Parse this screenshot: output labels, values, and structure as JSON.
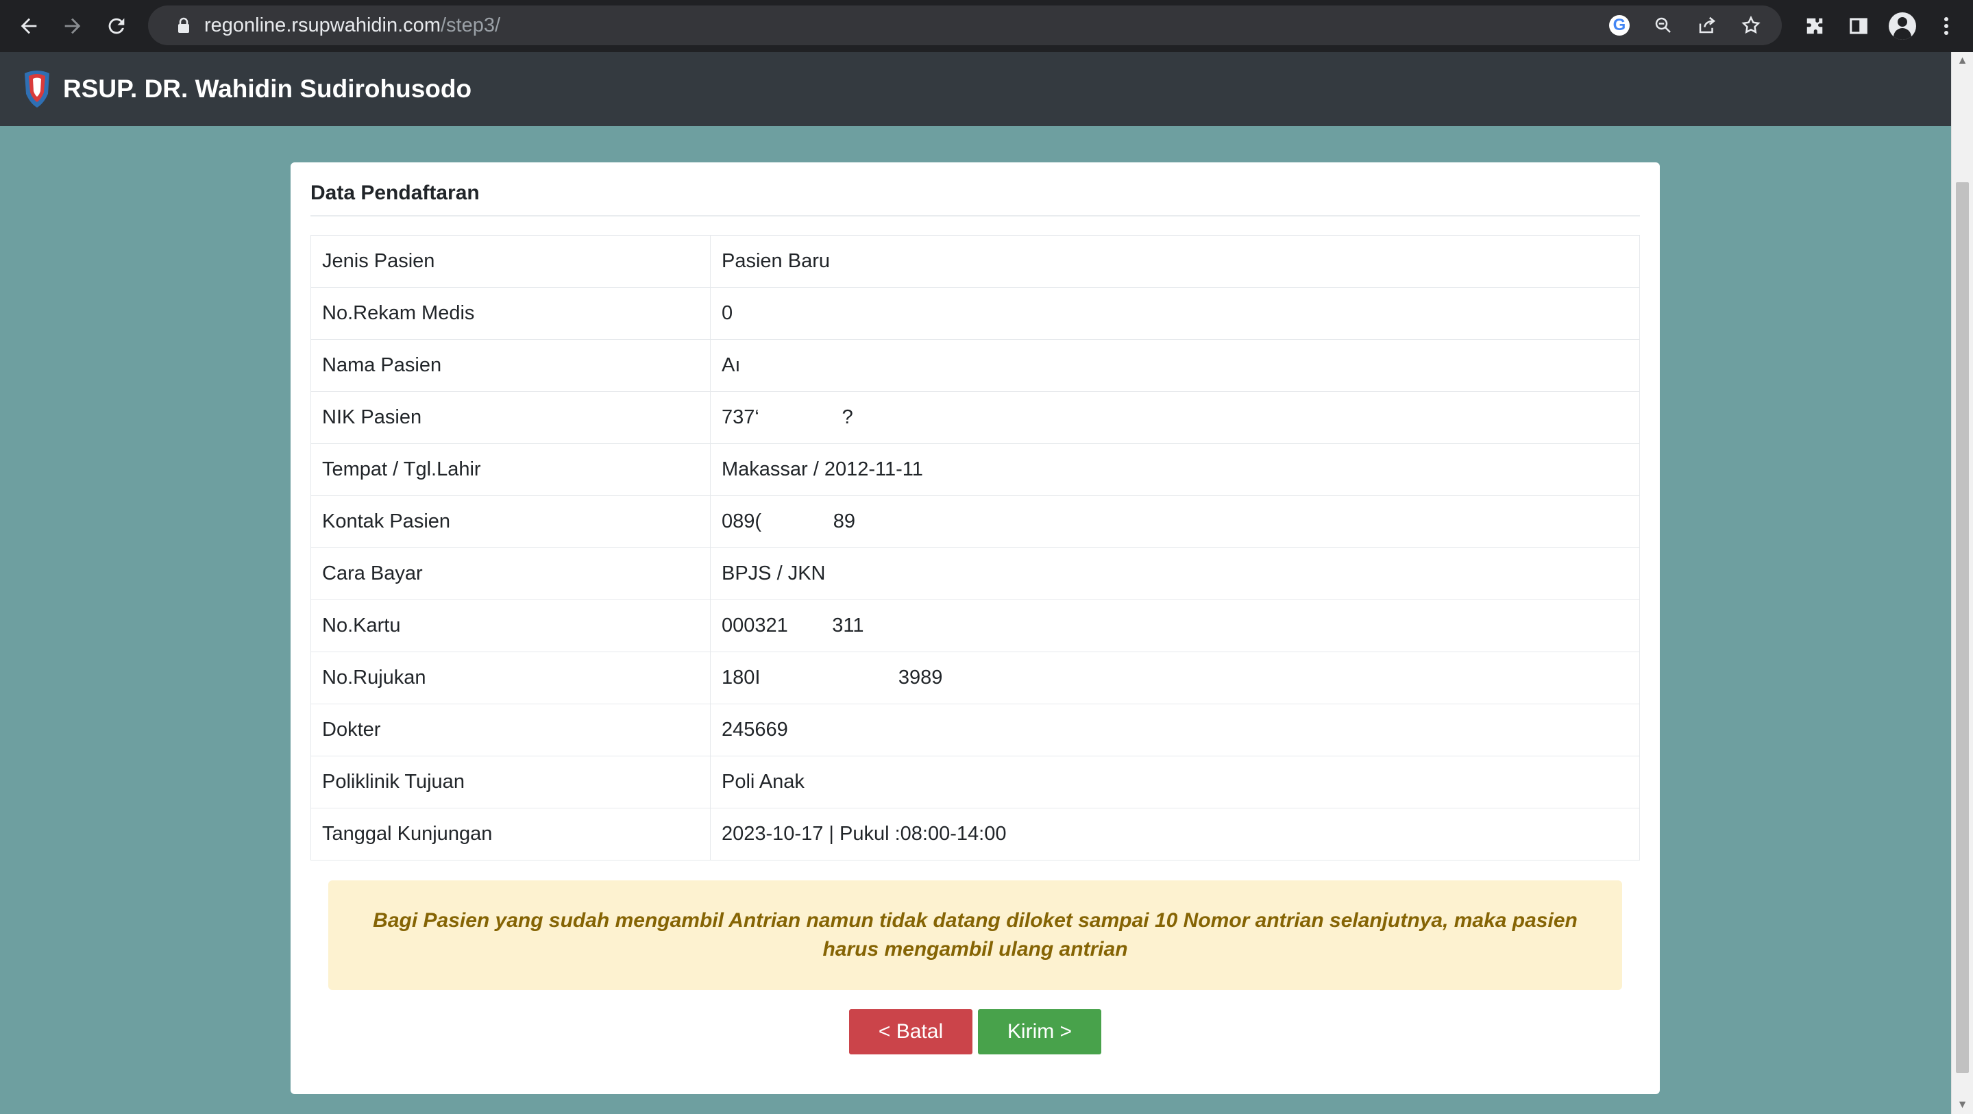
{
  "browser": {
    "url_host": "regonline.rsupwahidin.com",
    "url_path": "/step3/"
  },
  "navbar": {
    "brand": "RSUP. DR. Wahidin Sudirohusodo"
  },
  "card": {
    "title": "Data Pendaftaran",
    "rows": [
      {
        "label": "Jenis Pasien",
        "value": "Pasien Baru"
      },
      {
        "label": "No.Rekam Medis",
        "value": "0"
      },
      {
        "label": "Nama Pasien",
        "value": "Aı"
      },
      {
        "label": "NIK Pasien",
        "value": "737‘               ?"
      },
      {
        "label": "Tempat / Tgl.Lahir",
        "value": "Makassar / 2012-11-11"
      },
      {
        "label": "Kontak Pasien",
        "value": "089(             89"
      },
      {
        "label": "Cara Bayar",
        "value": "BPJS / JKN"
      },
      {
        "label": "No.Kartu",
        "value": "000321        311"
      },
      {
        "label": "No.Rujukan",
        "value": "180I                         3989"
      },
      {
        "label": "Dokter",
        "value": "245669"
      },
      {
        "label": "Poliklinik Tujuan",
        "value": "Poli Anak"
      },
      {
        "label": "Tanggal Kunjungan",
        "value": "2023-10-17 | Pukul :08:00-14:00"
      }
    ],
    "notice": "Bagi Pasien yang sudah mengambil Antrian namun tidak datang diloket sampai 10 Nomor antrian selanjutnya, maka pasien harus mengambil ulang antrian",
    "cancel_label": "< Batal",
    "submit_label": "Kirim >"
  }
}
